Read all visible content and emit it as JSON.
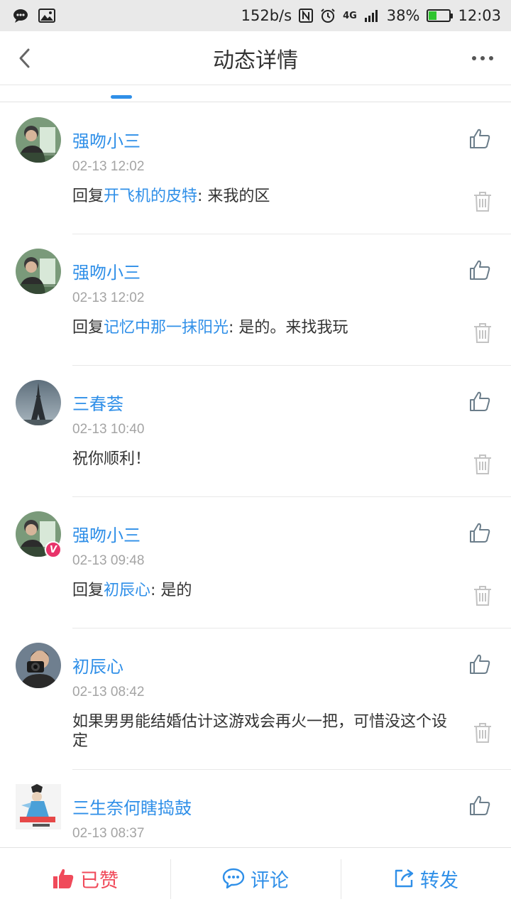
{
  "status_bar": {
    "speed": "152b/s",
    "network": "4G",
    "battery": "38%",
    "battery_level": 0.38,
    "time": "12:03"
  },
  "header": {
    "title": "动态详情"
  },
  "comments": [
    {
      "user": "强吻小三",
      "time": "02-13 12:02",
      "prefix": "回复",
      "mention": "开飞机的皮特",
      "body": ": 来我的区"
    },
    {
      "user": "强吻小三",
      "time": "02-13 12:02",
      "prefix": "回复",
      "mention": "记忆中那一抹阳光",
      "body": ": 是的。来找我玩"
    },
    {
      "user": "三春荟",
      "time": "02-13 10:40",
      "prefix": "",
      "mention": "",
      "body": "祝你顺利！"
    },
    {
      "user": "强吻小三",
      "time": "02-13 09:48",
      "prefix": "回复",
      "mention": "初辰心",
      "body": ": 是的",
      "badge": "V"
    },
    {
      "user": "初辰心",
      "time": "02-13 08:42",
      "prefix": "",
      "mention": "",
      "body": "如果男男能结婚估计这游戏会再火一把，可惜没这个设定"
    },
    {
      "user": "三生奈何瞎捣鼓",
      "time": "02-13 08:37",
      "prefix": "",
      "mention": "",
      "body": ""
    }
  ],
  "bottom_bar": {
    "liked_label": "已赞",
    "comment_label": "评论",
    "share_label": "转发"
  },
  "colors": {
    "accent": "#2f8fe8",
    "liked": "#f04a5a",
    "time": "#a4a4a4"
  }
}
